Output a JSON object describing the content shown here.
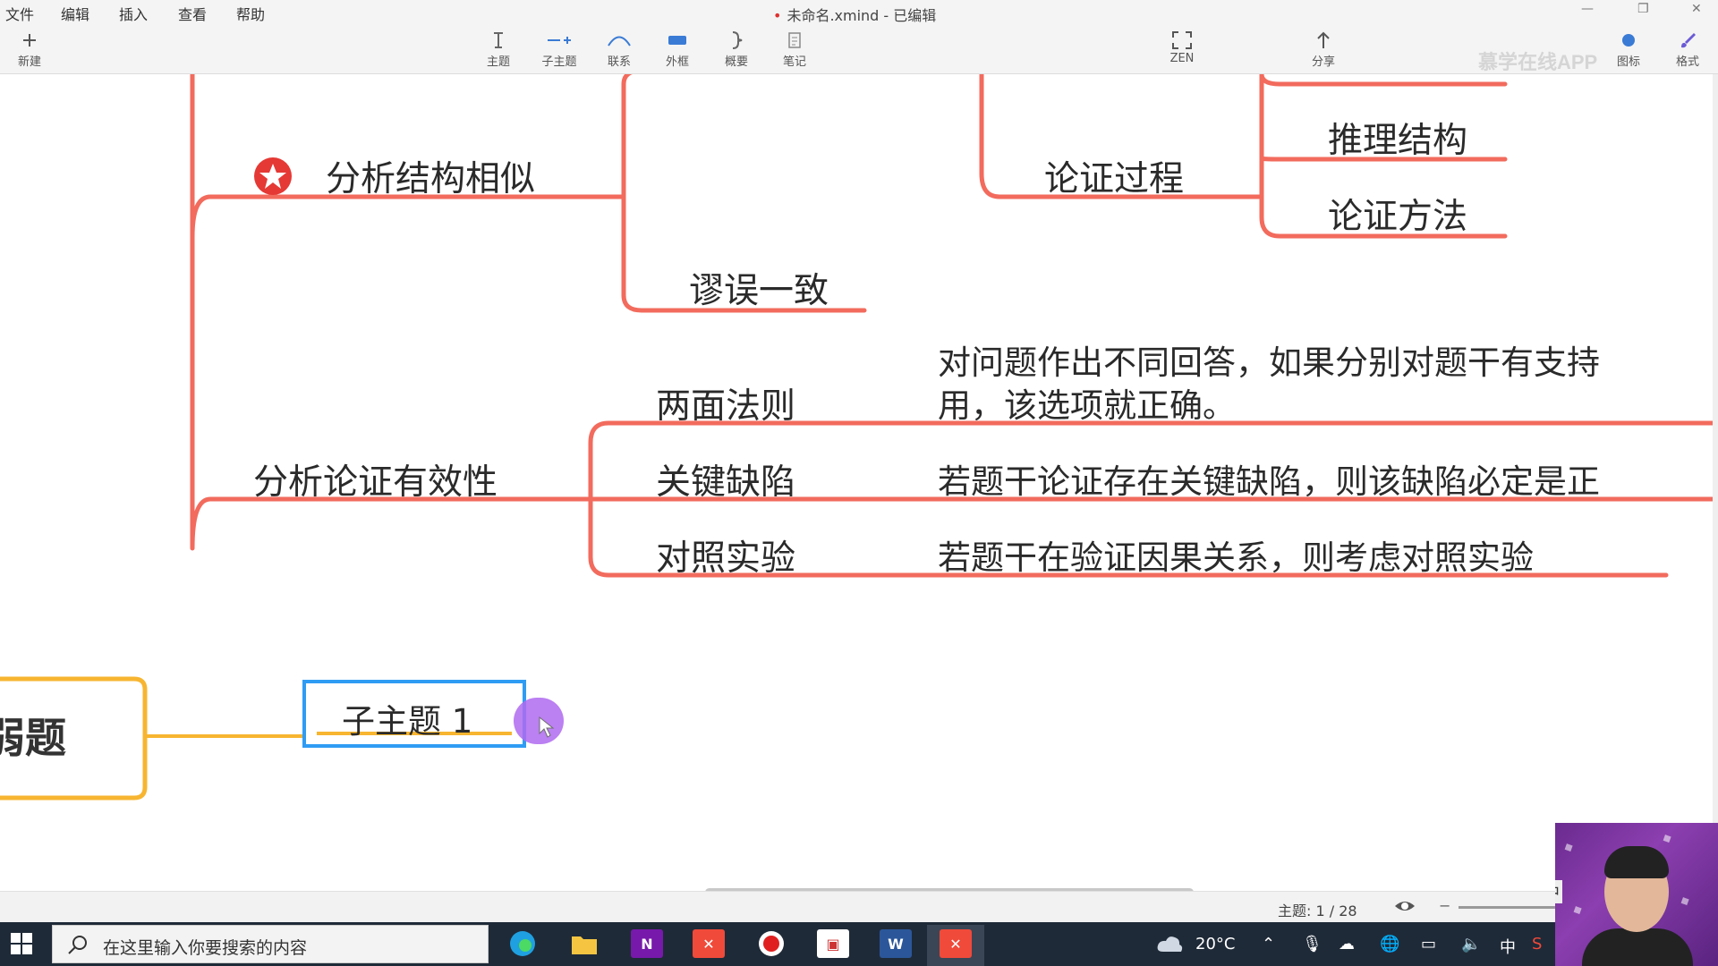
{
  "menubar": {
    "items": [
      "文件",
      "编辑",
      "插入",
      "查看",
      "帮助"
    ],
    "document_title": "未命名.xmind - 已编辑"
  },
  "toolbar": {
    "new_label": "新建",
    "tools": [
      "主题",
      "子主题",
      "联系",
      "外框",
      "概要",
      "笔记"
    ],
    "zen_label": "ZEN",
    "share_label": "分享",
    "icon_label": "图标",
    "format_label": "格式"
  },
  "watermark": "慕学在线APP",
  "mindmap": {
    "node_analyze_structure": "分析结构相似",
    "node_fallacy": "谬误一致",
    "node_argument_process": "论证过程",
    "node_reasoning_structure": "推理结构",
    "node_argument_method": "论证方法",
    "node_analyze_validity": "分析论证有效性",
    "node_two_sides": "两面法则",
    "node_two_sides_desc_1": "对问题作出不同回答，如果分别对题干有支持",
    "node_two_sides_desc_2": "用，该选项就正确。",
    "node_key_defect": "关键缺陷",
    "node_key_defect_desc": "若题干论证存在关键缺陷，则该缺陷必定是正",
    "node_control_exp": "对照实验",
    "node_control_exp_desc": "若题干在验证因果关系，则考虑对照实验",
    "node_main_partial": "弱题",
    "node_subtopic": "子主题 1"
  },
  "statusbar": {
    "topic_count": "主题: 1 / 28"
  },
  "taskbar": {
    "search_placeholder": "在这里输入你要搜索的内容",
    "weather": "20°C",
    "ime": "中"
  },
  "webcam": {
    "ime_indicator": "中"
  },
  "colors": {
    "branch_red": "#f26b5d",
    "branch_orange": "#f7b530",
    "select_blue": "#2f9cf4",
    "star_red": "#e53935",
    "cursor_purple": "#b06bf0"
  }
}
